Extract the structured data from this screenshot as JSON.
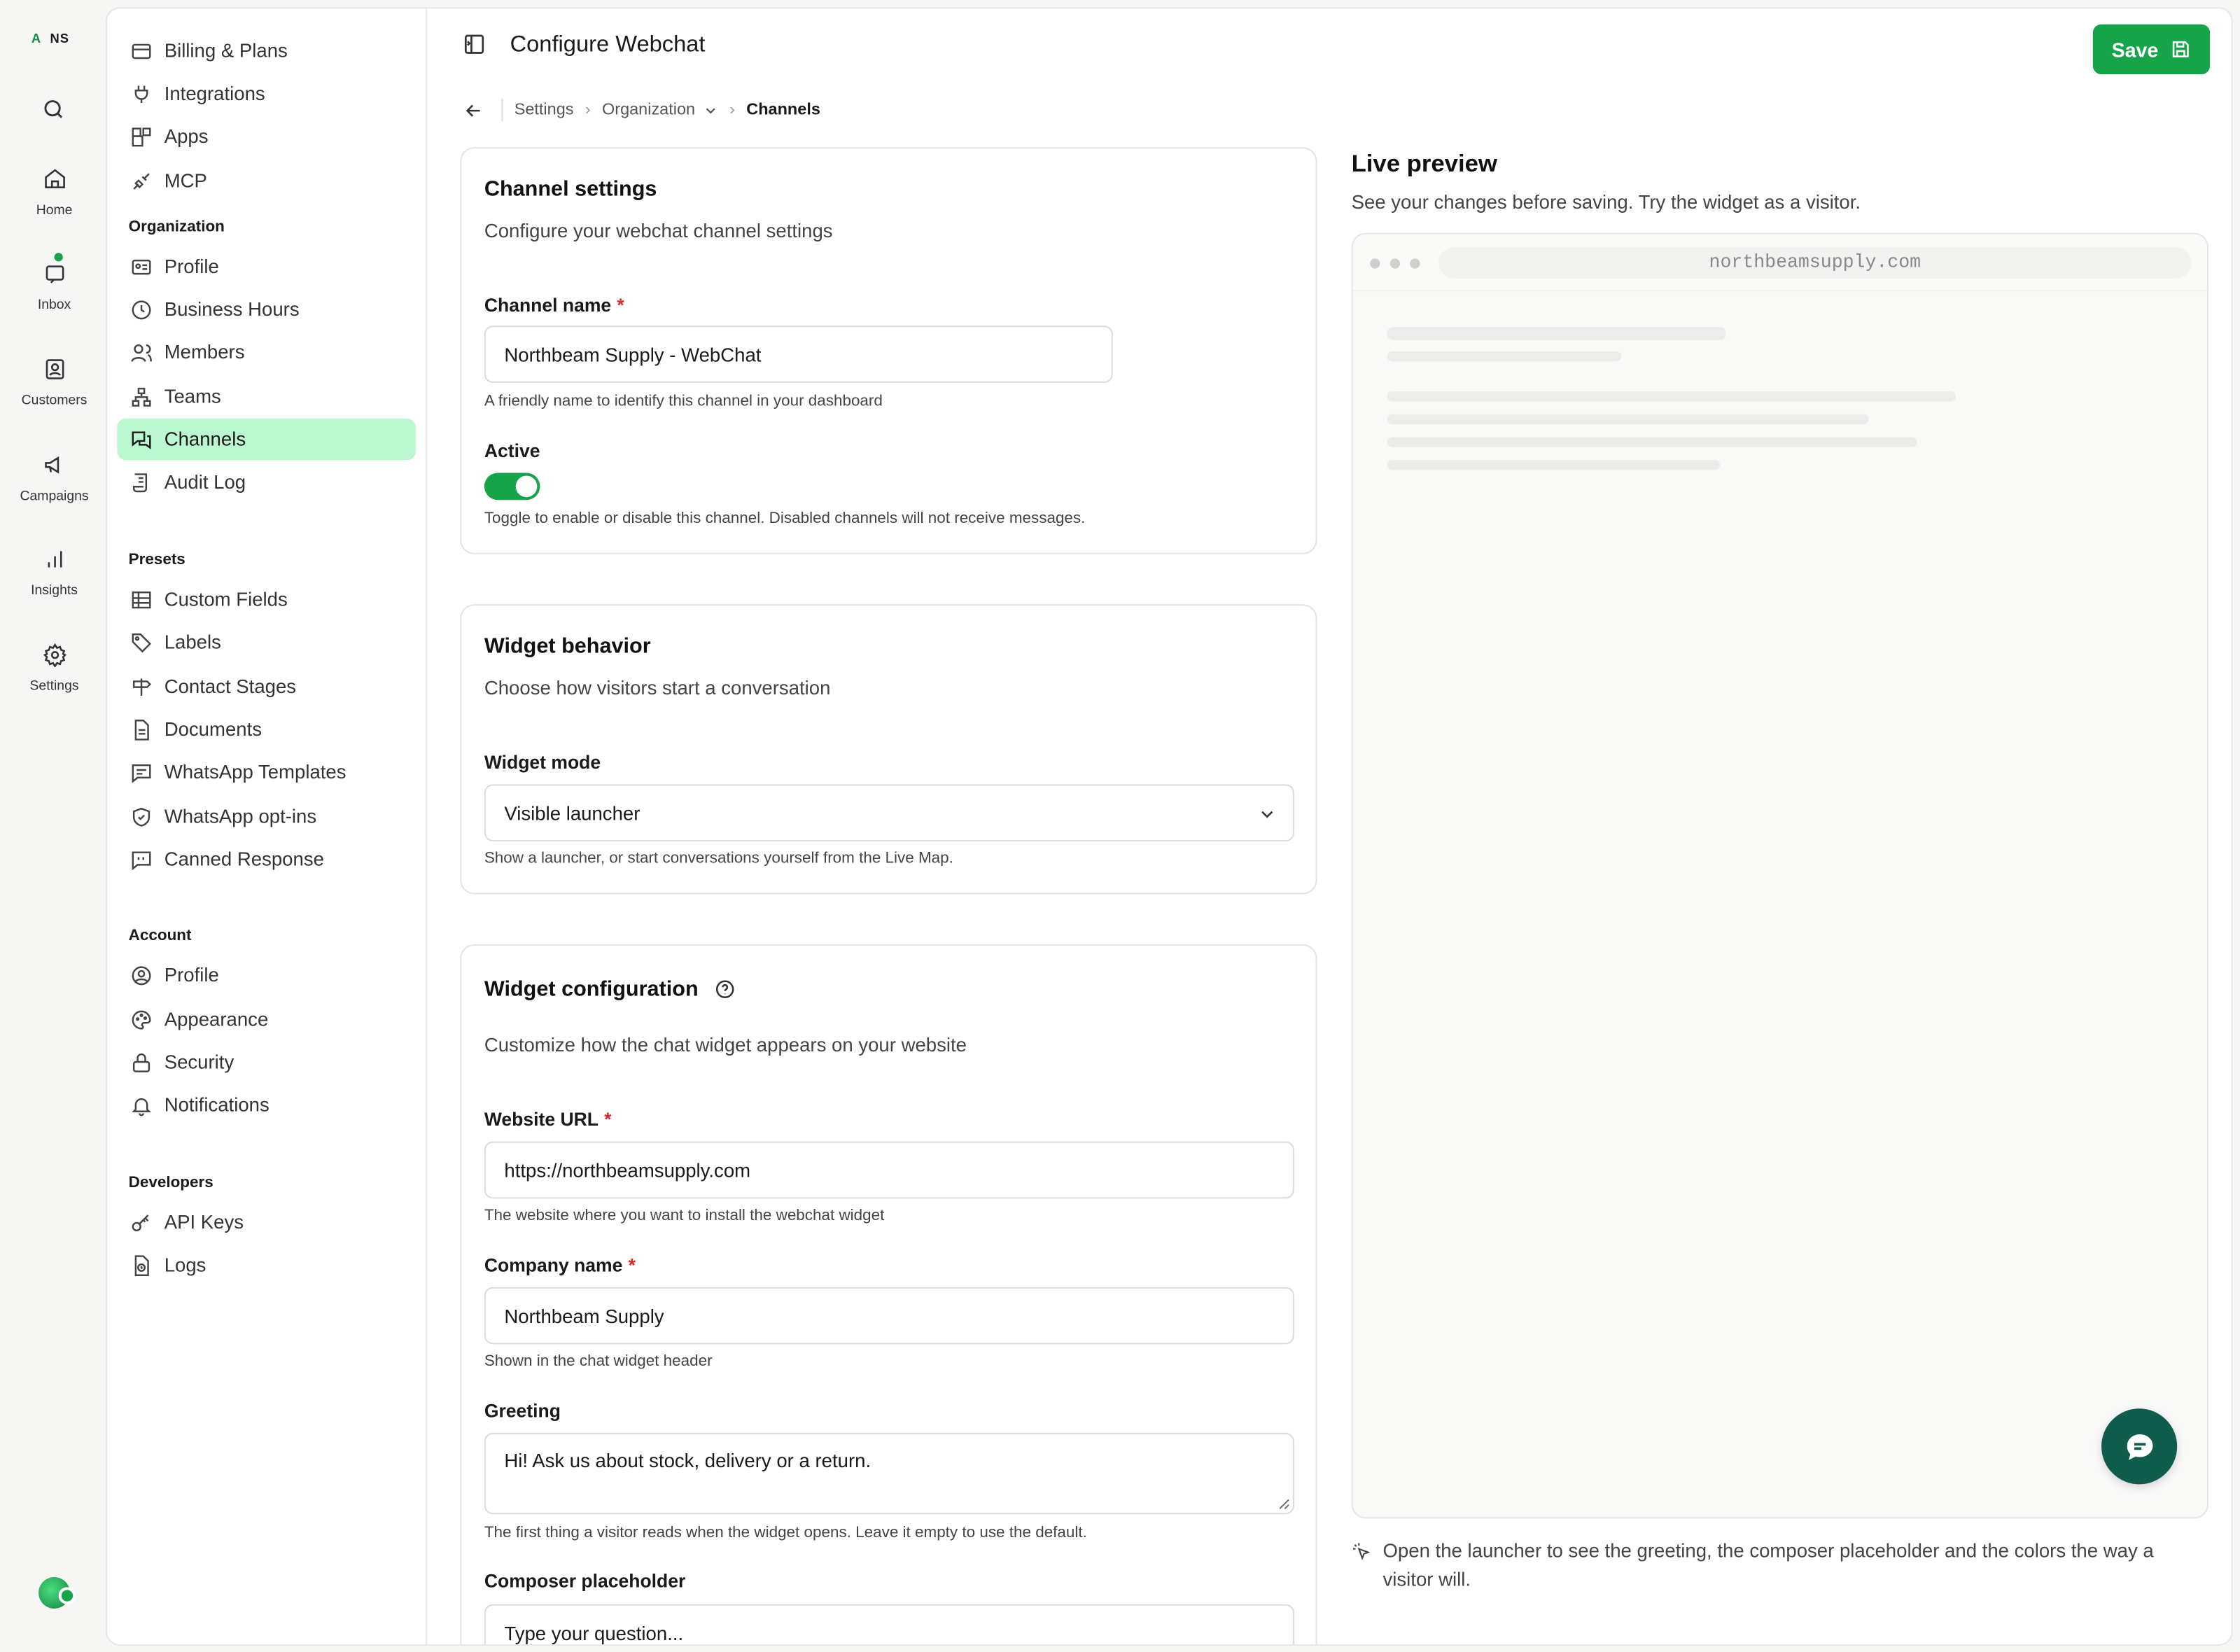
{
  "workspace": {
    "initials_a": "A",
    "initials_b": "NS"
  },
  "rail": [
    {
      "label": "Home",
      "icon": "home-icon"
    },
    {
      "label": "Inbox",
      "icon": "inbox-icon"
    },
    {
      "label": "Customers",
      "icon": "customers-icon"
    },
    {
      "label": "Campaigns",
      "icon": "megaphone-icon"
    },
    {
      "label": "Insights",
      "icon": "bar-chart-icon"
    },
    {
      "label": "Settings",
      "icon": "gear-icon"
    }
  ],
  "nav": {
    "top": [
      "Billing & Plans",
      "Integrations",
      "Apps",
      "MCP"
    ],
    "org_head": "Organization",
    "org": [
      "Profile",
      "Business Hours",
      "Members",
      "Teams",
      "Channels",
      "Audit Log"
    ],
    "presets_head": "Presets",
    "presets": [
      "Custom Fields",
      "Labels",
      "Contact Stages",
      "Documents",
      "WhatsApp Templates",
      "WhatsApp opt-ins",
      "Canned Response"
    ],
    "account_head": "Account",
    "account": [
      "Profile",
      "Appearance",
      "Security",
      "Notifications"
    ],
    "dev_head": "Developers",
    "dev": [
      "API Keys",
      "Logs"
    ]
  },
  "header": {
    "title": "Configure Webchat",
    "save": "Save"
  },
  "breadcrumb": {
    "settings": "Settings",
    "organization": "Organization",
    "current": "Channels"
  },
  "channel": {
    "title": "Channel settings",
    "sub": "Configure your webchat channel settings",
    "name_label": "Channel name",
    "name_value": "Northbeam Supply - WebChat",
    "name_help": "A friendly name to identify this channel in your dashboard",
    "active_label": "Active",
    "active": true,
    "active_help": "Toggle to enable or disable this channel. Disabled channels will not receive messages."
  },
  "behavior": {
    "title": "Widget behavior",
    "sub": "Choose how visitors start a conversation",
    "mode_label": "Widget mode",
    "mode_value": "Visible launcher",
    "mode_help": "Show a launcher, or start conversations yourself from the Live Map."
  },
  "config": {
    "title": "Widget configuration",
    "sub": "Customize how the chat widget appears on your website",
    "url_label": "Website URL",
    "url_value": "https://northbeamsupply.com",
    "url_help": "The website where you want to install the webchat widget",
    "company_label": "Company name",
    "company_value": "Northbeam Supply",
    "company_help": "Shown in the chat widget header",
    "greeting_label": "Greeting",
    "greeting_value": "Hi! Ask us about stock, delivery or a return.",
    "greeting_help": "The first thing a visitor reads when the widget opens. Leave it empty to use the default.",
    "placeholder_label": "Composer placeholder",
    "placeholder_value": "Type your question..."
  },
  "preview": {
    "title": "Live preview",
    "sub": "See your changes before saving. Try the widget as a visitor.",
    "url": "northbeamsupply.com",
    "note": "Open the launcher to see the greeting, the composer placeholder and the colors the way a visitor will."
  },
  "colors": {
    "accent": "#16a34a",
    "active_nav": "#bbf7d0",
    "launcher": "#0f5c4c"
  }
}
